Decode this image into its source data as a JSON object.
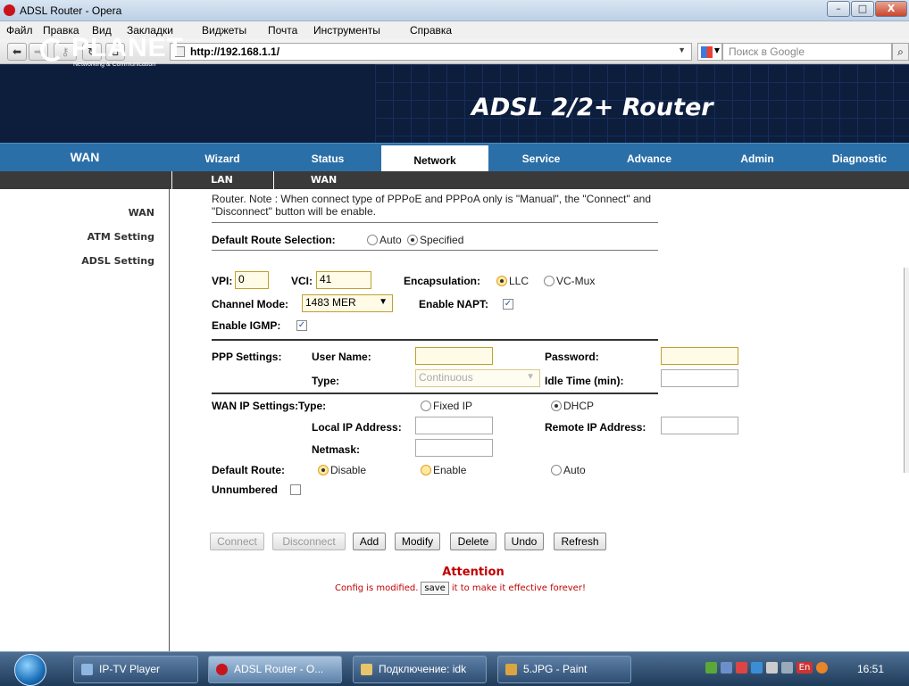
{
  "window": {
    "title": "ADSL Router - Opera",
    "minimize": "–",
    "maximize": "□",
    "close": "X"
  },
  "menu": [
    "Файл",
    "Правка",
    "Вид",
    "Закладки",
    "Виджеты",
    "Почта",
    "Инструменты",
    "Справка"
  ],
  "toolbar": {
    "url": "http://192.168.1.1/",
    "search_placeholder": "Поиск в Google"
  },
  "brand": {
    "logo": "PLANET",
    "tagline": "Networking & Communication",
    "product": "ADSL 2/2+ Router"
  },
  "nav": {
    "section": "WAN",
    "tabs": [
      "Wizard",
      "Status",
      "Network",
      "Service",
      "Advance",
      "Admin",
      "Diagnostic"
    ],
    "active": "Network",
    "subtabs": [
      "LAN",
      "WAN"
    ]
  },
  "sidebar": [
    "WAN",
    "ATM Setting",
    "ADSL Setting"
  ],
  "note": "Router. Note : When connect type of PPPoE and PPPoA only is \"Manual\", the \"Connect\" and \"Disconnect\" button will be enable.",
  "route": {
    "label": "Default Route Selection:",
    "opt_auto": "Auto",
    "opt_specified": "Specified",
    "selected": "Specified"
  },
  "atm": {
    "vpi_label": "VPI:",
    "vpi": "0",
    "vci_label": "VCI:",
    "vci": "41",
    "encap_label": "Encapsulation:",
    "encap_llc": "LLC",
    "encap_vcmux": "VC-Mux",
    "encap_selected": "LLC",
    "channel_label": "Channel Mode:",
    "channel_value": "1483 MER",
    "napt_label": "Enable NAPT:",
    "napt_checked": true,
    "igmp_label": "Enable IGMP:",
    "igmp_checked": true
  },
  "ppp": {
    "section": "PPP Settings:",
    "user_label": "User Name:",
    "user": "",
    "password_label": "Password:",
    "password": "",
    "type_label": "Type:",
    "type_value": "Continuous",
    "idle_label": "Idle Time (min):",
    "idle": ""
  },
  "wanip": {
    "section": "WAN IP Settings:",
    "type_label": "Type:",
    "fixed_ip": "Fixed IP",
    "dhcp": "DHCP",
    "selected": "DHCP",
    "local_label": "Local IP Address:",
    "local": "",
    "remote_label": "Remote IP Address:",
    "remote": "",
    "netmask_label": "Netmask:",
    "netmask": ""
  },
  "default_route": {
    "label": "Default Route:",
    "disable": "Disable",
    "enable": "Enable",
    "auto": "Auto",
    "selected": "Disable"
  },
  "unnumbered": {
    "label": "Unnumbered",
    "checked": false
  },
  "buttons": {
    "connect": "Connect",
    "disconnect": "Disconnect",
    "add": "Add",
    "modify": "Modify",
    "delete": "Delete",
    "undo": "Undo",
    "refresh": "Refresh"
  },
  "attention": {
    "title": "Attention",
    "pre": "Config is modified.",
    "save": "save",
    "post": "it to make it effective forever!"
  },
  "taskbar": {
    "items": [
      "IP-TV Player",
      "ADSL Router - O...",
      "Подключение: idk",
      "5.JPG - Paint"
    ],
    "lang": "En",
    "clock": "16:51"
  }
}
